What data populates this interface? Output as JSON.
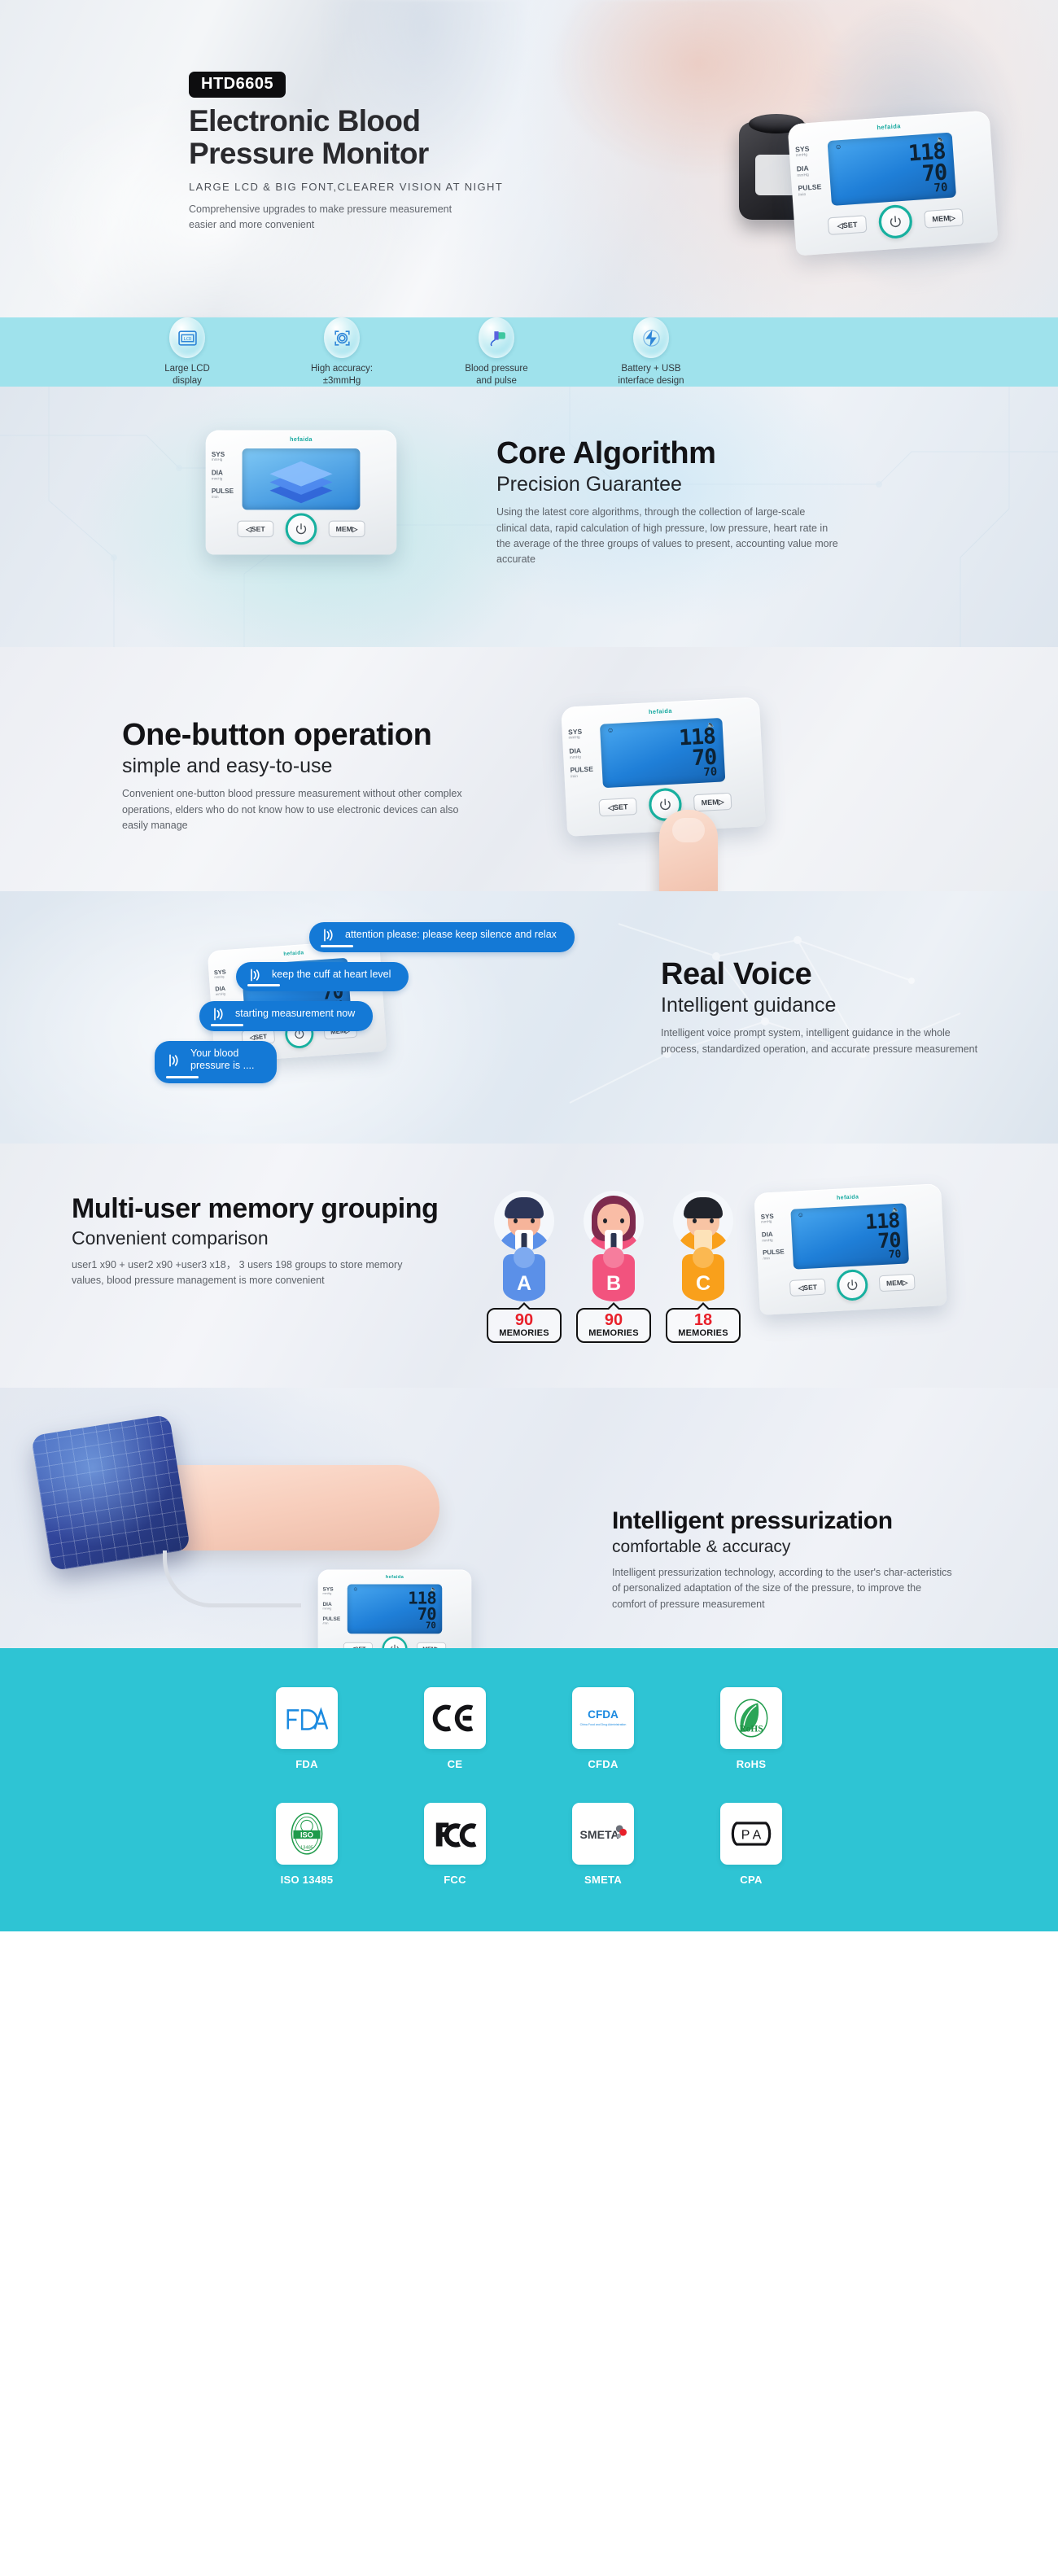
{
  "hero": {
    "model_badge": "HTD6605",
    "title_line1": "Electronic Blood",
    "title_line2": "Pressure Monitor",
    "kicker": "LARGE LCD & BIG FONT,CLEARER VISION AT NIGHT",
    "description": "Comprehensive upgrades to make pressure measurement easier and more convenient"
  },
  "device": {
    "brand": "hefaida",
    "sys_label": "SYS",
    "sys_unit": "mmHg",
    "dia_label": "DIA",
    "dia_unit": "mmHg",
    "pulse_label": "PULSE",
    "pulse_unit": "/min",
    "sys_value": "118",
    "dia_value": "70",
    "pulse_value": "70",
    "set_button": "◁SET",
    "mem_button": "MEM▷",
    "power_icon": "power-icon"
  },
  "features": {
    "items": [
      {
        "icon": "lcd-screen-icon",
        "line1": "Large LCD",
        "line2": "display"
      },
      {
        "icon": "target-accuracy-icon",
        "line1": "High accuracy:",
        "line2": "±3mmHg"
      },
      {
        "icon": "cuff-pulse-icon",
        "line1": "Blood pressure",
        "line2": "and pulse"
      },
      {
        "icon": "battery-usb-icon",
        "line1": "Battery + USB",
        "line2": "interface design"
      }
    ]
  },
  "core_algorithm": {
    "title": "Core Algorithm",
    "subtitle": "Precision Guarantee",
    "body": "Using the latest core algorithms, through the collection of large-scale clinical data, rapid calculation of high pressure, low pressure, heart rate in the average of the three groups of values to present, accounting value more accurate"
  },
  "one_button": {
    "title": "One-button operation",
    "subtitle": "simple and easy-to-use",
    "body": "Convenient one-button blood pressure measurement without other complex operations, elders who do not know how to use electronic devices can also easily manage"
  },
  "real_voice": {
    "title": "Real Voice",
    "subtitle": "Intelligent guidance",
    "body": "Intelligent voice prompt system, intelligent guidance in the whole process, standardized operation, and accurate pressure measurement",
    "prompts": [
      "attention please:  please keep silence and relax",
      "keep the cuff at heart level",
      "starting measurement now",
      "Your blood pressure is ...."
    ]
  },
  "multi_user": {
    "title": "Multi-user memory grouping",
    "subtitle": "Convenient comparison",
    "body": "user1 x90 + user2 x90 +user3 x18， 3 users 198 groups to store memory values, blood pressure management is more convenient",
    "users": [
      {
        "letter": "A",
        "memories": "90",
        "memories_label": "MEMORIES",
        "color": "#5b90e8"
      },
      {
        "letter": "B",
        "memories": "90",
        "memories_label": "MEMORIES",
        "color": "#f2537e"
      },
      {
        "letter": "C",
        "memories": "18",
        "memories_label": "MEMORIES",
        "color": "#f9a01b"
      }
    ]
  },
  "pressurization": {
    "title": "Intelligent pressurization",
    "subtitle": "comfortable & accuracy",
    "body": "Intelligent pressurization technology, according to the user's char-acteristics of personalized adaptation of the size of the pressure, to improve the comfort of pressure measurement"
  },
  "certifications": {
    "background": "#2ec4d4",
    "row1": [
      {
        "icon": "fda-logo-icon",
        "label": "FDA"
      },
      {
        "icon": "ce-mark-icon",
        "label": "CE"
      },
      {
        "icon": "cfda-logo-icon",
        "label": "CFDA",
        "sub": "China Food and Drug Administration"
      },
      {
        "icon": "rohs-logo-icon",
        "label": "RoHS"
      }
    ],
    "row2": [
      {
        "icon": "iso-logo-icon",
        "label": "ISO 13485",
        "sub": "13485"
      },
      {
        "icon": "fcc-logo-icon",
        "label": "FCC"
      },
      {
        "icon": "smeta-logo-icon",
        "label": "SMETA"
      },
      {
        "icon": "cpa-logo-icon",
        "label": "CPA"
      }
    ]
  }
}
